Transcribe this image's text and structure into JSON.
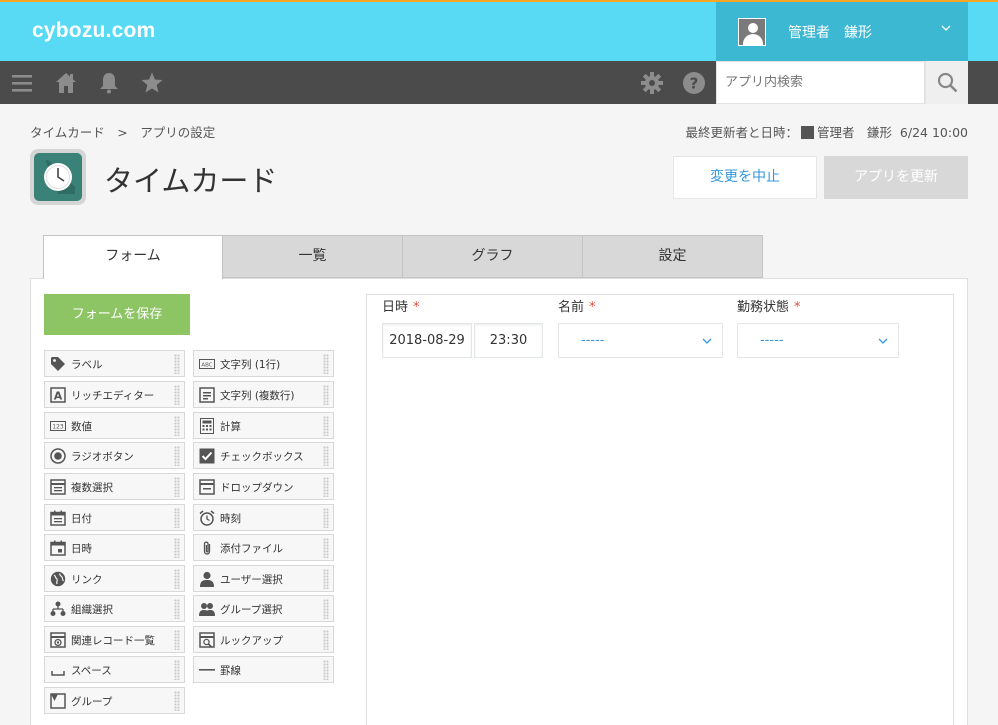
{
  "topbar": {
    "logo": "cybozu.com",
    "user_name": "管理者　鎌形"
  },
  "navbar": {
    "search_placeholder": "アプリ内検索"
  },
  "header": {
    "breadcrumb": "タイムカード　>　アプリの設定",
    "updated_prefix": "最終更新者と日時：",
    "updated_user": "管理者　鎌形",
    "updated_time": "6/24 10:00",
    "app_title": "タイムカード",
    "cancel_label": "変更を中止",
    "update_label": "アプリを更新"
  },
  "tabs": [
    {
      "label": "フォーム",
      "active": true
    },
    {
      "label": "一覧",
      "active": false
    },
    {
      "label": "グラフ",
      "active": false
    },
    {
      "label": "設定",
      "active": false
    }
  ],
  "save_form_label": "フォームを保存",
  "palette": [
    {
      "label": "ラベル",
      "icon": "tag-icon"
    },
    {
      "label": "文字列 (1行)",
      "icon": "abc-icon"
    },
    {
      "label": "リッチエディター",
      "icon": "rich-editor-icon"
    },
    {
      "label": "文字列 (複数行)",
      "icon": "multiline-icon"
    },
    {
      "label": "数値",
      "icon": "number-icon"
    },
    {
      "label": "計算",
      "icon": "calculator-icon"
    },
    {
      "label": "ラジオボタン",
      "icon": "radio-icon"
    },
    {
      "label": "チェックボックス",
      "icon": "checkbox-icon"
    },
    {
      "label": "複数選択",
      "icon": "multiselect-icon"
    },
    {
      "label": "ドロップダウン",
      "icon": "dropdown-icon"
    },
    {
      "label": "日付",
      "icon": "date-icon"
    },
    {
      "label": "時刻",
      "icon": "clock-icon"
    },
    {
      "label": "日時",
      "icon": "datetime-icon"
    },
    {
      "label": "添付ファイル",
      "icon": "paperclip-icon"
    },
    {
      "label": "リンク",
      "icon": "globe-icon"
    },
    {
      "label": "ユーザー選択",
      "icon": "user-icon"
    },
    {
      "label": "組織選択",
      "icon": "organization-icon"
    },
    {
      "label": "グループ選択",
      "icon": "group-icon"
    },
    {
      "label": "関連レコード一覧",
      "icon": "related-records-icon"
    },
    {
      "label": "ルックアップ",
      "icon": "lookup-icon"
    },
    {
      "label": "スペース",
      "icon": "space-icon"
    },
    {
      "label": "罫線",
      "icon": "line-icon"
    },
    {
      "label": "グループ",
      "icon": "group-field-icon"
    }
  ],
  "form": {
    "fields": [
      {
        "label": "日時",
        "required_mark": "*"
      },
      {
        "label": "名前",
        "required_mark": "*"
      },
      {
        "label": "勤務状態",
        "required_mark": "*"
      }
    ],
    "date_value": "2018-08-29",
    "time_value": "23:30",
    "name_select": "-----",
    "status_select": "-----"
  },
  "colors": {
    "topbar": "#58daf5",
    "user_area": "#3cb8d3",
    "navbar": "#4b4b4b",
    "save_button": "#8dc565",
    "link_blue": "#3498db",
    "required_red": "#e74c3c"
  }
}
